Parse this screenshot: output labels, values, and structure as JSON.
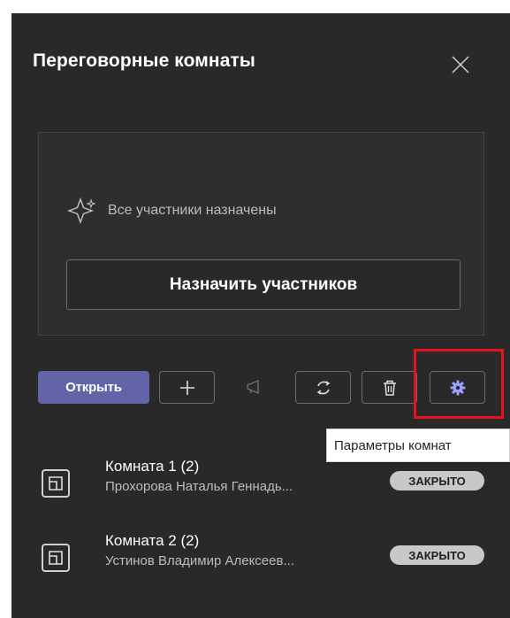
{
  "header": {
    "title": "Переговорные комнаты"
  },
  "assign": {
    "status": "Все участники назначены",
    "button": "Назначить участников"
  },
  "toolbar": {
    "open_label": "Открыть",
    "settings_tooltip": "Параметры комнат"
  },
  "rooms": [
    {
      "name": "Комната 1 (2)",
      "participants": "Прохорова Наталья Геннадь...",
      "status": "ЗАКРЫТО"
    },
    {
      "name": "Комната 2 (2)",
      "participants": "Устинов Владимир Алексеев...",
      "status": "ЗАКРЫТО"
    }
  ],
  "colors": {
    "panel_bg": "#292929",
    "accent": "#6264a7",
    "highlight": "#e3151a"
  }
}
